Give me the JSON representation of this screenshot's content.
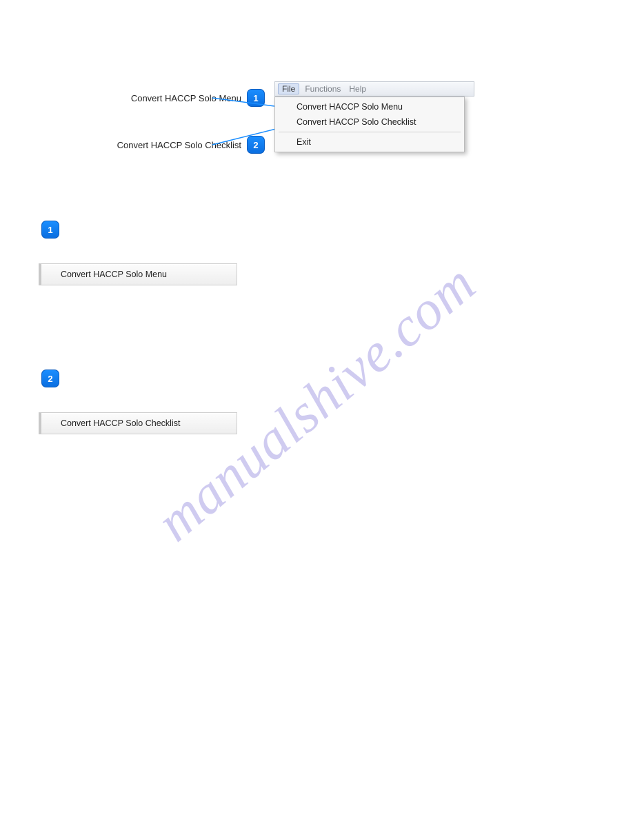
{
  "watermark": "manualshive.com",
  "labels": {
    "l1": "Convert HACCP Solo Menu",
    "l2": "Convert HACCP Solo Checklist"
  },
  "badges": {
    "b1": "1",
    "b2": "2"
  },
  "menubar": {
    "file": "File",
    "functions": "Functions",
    "help": "Help"
  },
  "dropdown": {
    "item1": "Convert HACCP Solo Menu",
    "item2": "Convert HACCP Solo Checklist",
    "item3": "Exit"
  },
  "listbox": {
    "box1": "Convert HACCP Solo Menu",
    "box2": "Convert HACCP Solo Checklist"
  }
}
